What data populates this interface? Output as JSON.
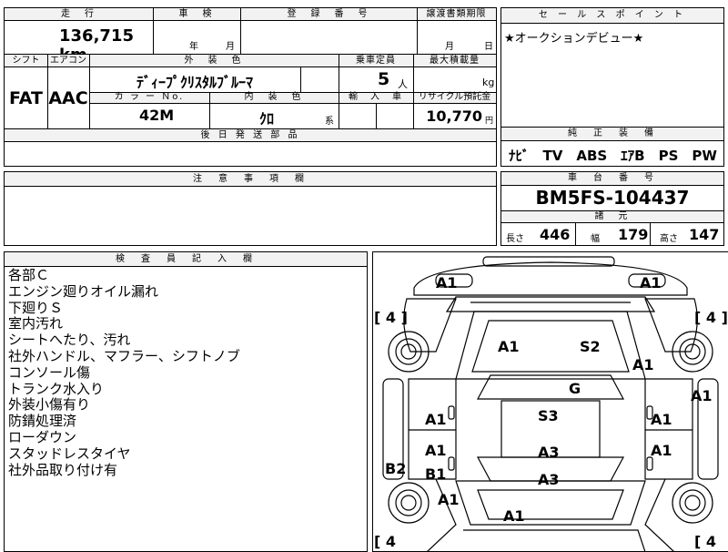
{
  "header": {
    "mileage_label": "走　行",
    "mileage_value": "136,715",
    "mileage_unit": "km",
    "inspection_label": "車　検",
    "inspection_year": "年",
    "inspection_month": "月",
    "reg_label": "登　録　番　号",
    "transfer_label": "譲渡書類期限",
    "transfer_month": "月",
    "transfer_day": "日"
  },
  "spec": {
    "shift_label": "シフト",
    "shift_value": "FAT",
    "ac_label": "エアコン",
    "ac_value": "AAC",
    "exterior_label": "外　装　色",
    "exterior_value": "ﾃﾞｨｰﾌﾟｸﾘｽﾀﾙﾌﾞﾙｰﾏ",
    "capacity_label": "乗車定員",
    "capacity_value": "5",
    "capacity_unit": "人",
    "maxload_label": "最大積載量",
    "maxload_unit": "kg",
    "colorno_label": "カ ラ ー Ｎo.",
    "colorno_value": "42M",
    "interior_label": "内　装　色",
    "interior_value": "ｸﾛ",
    "interior_suffix": "系",
    "import_label": "輸　入　車",
    "recycle_label": "リサイクル預託金",
    "recycle_value": "10,770",
    "recycle_unit": "円",
    "later_parts_label": "後 日 発 送 部 品"
  },
  "sales": {
    "title": "セ ー ル ス ポ イ ン ト",
    "text": "★オークションデビュー★"
  },
  "equipment": {
    "title": "純　正　装　備",
    "text": "ﾅﾋﾞ　TV　ABS　ｴｱB　PS　PW"
  },
  "caution": {
    "title": "注　意　事　項　欄"
  },
  "chassis": {
    "title": "車　台　番　号",
    "value": "BM5FS-104437",
    "dims_title": "諸　元",
    "length_label": "長さ",
    "length_value": "446",
    "width_label": "幅",
    "width_value": "179",
    "height_label": "高さ",
    "height_value": "147"
  },
  "inspector": {
    "title": "検　査　員　記　入　欄",
    "notes": [
      "各部Ｃ",
      "エンジン廻りオイル漏れ",
      "下廻りＳ",
      "室内汚れ",
      "シートへたり、汚れ",
      "社外ハンドル、マフラー、シフトノブ",
      "コンソール傷",
      "トランク水入り",
      "外装小傷有り",
      "防錆処理済",
      "ローダウン",
      "スタッドレスタイヤ",
      "社外品取り付け有"
    ]
  },
  "diagram": {
    "tire_marks": [
      "[ 4 ]",
      "[ 4 ]",
      "[ 4",
      "[ 4"
    ],
    "marks": [
      "A1",
      "A1",
      "A1",
      "S2",
      "A1",
      "A1",
      "G",
      "S3",
      "A1",
      "A1",
      "A1",
      "A1",
      "A3",
      "B2",
      "B1",
      "A3",
      "A1",
      "A1"
    ]
  }
}
